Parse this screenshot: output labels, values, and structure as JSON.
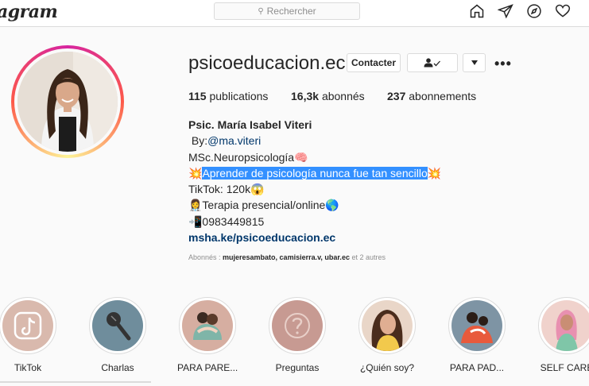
{
  "nav": {
    "logo": "agram",
    "search_placeholder": "Rechercher",
    "icons": [
      "home-icon",
      "direct-icon",
      "explore-icon",
      "activity-icon"
    ]
  },
  "profile": {
    "username": "psicoeducacion.ec",
    "contact_label": "Contacter",
    "more_label": "•••"
  },
  "stats": {
    "posts_count": "115",
    "posts_label": "publications",
    "followers_count": "16,3k",
    "followers_label": "abonnés",
    "following_count": "237",
    "following_label": "abonnements"
  },
  "bio": {
    "name": "Psic. María Isabel Viteri",
    "by_prefix": " By:",
    "mention": "@ma.viteri",
    "line_msc": "MSc.Neuropsicología🧠",
    "highlight_text": "Aprender de psicología nunca fue tan sencillo",
    "line_tiktok": "TikTok: 120k😱",
    "line_therapy": "👩‍⚕️Terapia presencial/online🌎",
    "line_phone": "📲0983449815",
    "link": "msha.ke/psicoeducacion.ec"
  },
  "followed_by": {
    "prefix": "Abonnés : ",
    "names": "mujeresambato, camisierra.v, ubar.ec",
    "suffix": " et 2 autres"
  },
  "highlights": [
    {
      "label": "TikTok",
      "icon": "tiktok-icon"
    },
    {
      "label": "Charlas",
      "icon": "microphone-icon"
    },
    {
      "label": "PARA PARE...",
      "icon": "hug-illustration"
    },
    {
      "label": "Preguntas",
      "icon": "question-icon"
    },
    {
      "label": "¿Quién soy?",
      "icon": "portrait-photo"
    },
    {
      "label": "PARA PAD...",
      "icon": "parents-illustration"
    },
    {
      "label": "SELF CARE",
      "icon": "selfcare-illustration"
    }
  ],
  "colors": {
    "link": "#00376b",
    "selection": "#3390ff",
    "muted": "#8e8e8e"
  }
}
